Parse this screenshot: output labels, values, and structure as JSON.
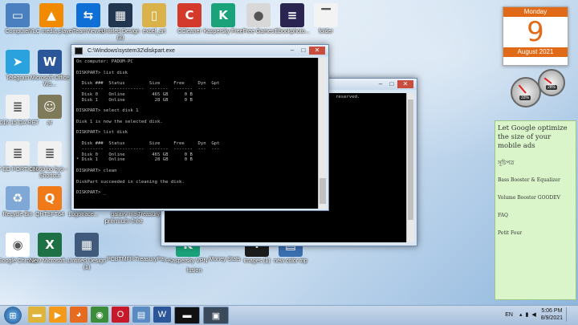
{
  "desktop_icons": [
    {
      "name": "computer",
      "label": "Computer",
      "color": "#4a7fc0",
      "glyph": "▭",
      "icon": "computer-icon"
    },
    {
      "name": "vlc",
      "label": "VLC media player",
      "color": "#f28a00",
      "glyph": "▲",
      "icon": "vlc-icon"
    },
    {
      "name": "teamviewer",
      "label": "TeamViewer",
      "color": "#0e6fd6",
      "glyph": "⇆",
      "icon": "teamviewer-icon"
    },
    {
      "name": "untitled-design-2",
      "label": "Untitled Design (2)",
      "color": "#23364f",
      "glyph": "▦",
      "icon": "image-icon"
    },
    {
      "name": "excel-art",
      "label": "excel_art",
      "color": "#d9b24a",
      "glyph": "▯",
      "icon": "folder-icon"
    },
    {
      "name": "ccleaner",
      "label": "CCleaner",
      "color": "#d33a2c",
      "glyph": "C",
      "icon": "ccleaner-icon"
    },
    {
      "name": "kaspersky-free",
      "label": "Kaspersky Free",
      "color": "#1aa37a",
      "glyph": "K",
      "icon": "kaspersky-icon"
    },
    {
      "name": "free-games",
      "label": "Free Games",
      "color": "#d8d8d8",
      "glyph": "●",
      "icon": "games-icon"
    },
    {
      "name": "ebookphoto",
      "label": "Ebookphoto...",
      "color": "#2a2450",
      "glyph": "≡",
      "icon": "image-icon"
    },
    {
      "name": "folder",
      "label": "folder",
      "color": "#f3f3f3",
      "glyph": "▔",
      "icon": "blank-icon"
    },
    {
      "name": "telegram",
      "label": "Telegram",
      "color": "#2aa2dd",
      "glyph": "➤",
      "icon": "telegram-icon"
    },
    {
      "name": "office-word",
      "label": "Microsoft Office Wo...",
      "color": "#2b579a",
      "glyph": "W",
      "icon": "word-icon"
    },
    {
      "name": "2016-15-da-ret",
      "label": "2016 15 DA RET",
      "color": "#f1f1f1",
      "glyph": "≣",
      "icon": "document-icon"
    },
    {
      "name": "ar",
      "label": "ar",
      "color": "#7e7a5a",
      "glyph": "☺",
      "icon": "photo-icon"
    },
    {
      "name": "7-ed-portion",
      "label": "7 ED PORTION",
      "color": "#f1f1f1",
      "glyph": "≣",
      "icon": "document-icon"
    },
    {
      "name": "8669-bo-hyo",
      "label": "8669 bo hyo - Shortcut",
      "color": "#f1f1f1",
      "glyph": "≣",
      "icon": "document-icon"
    },
    {
      "name": "recycle-bin",
      "label": "Recycle Bin",
      "color": "#7fa8d6",
      "glyph": "♻",
      "icon": "recycle-bin-icon"
    },
    {
      "name": "qhtsft64",
      "label": "QHTSFT64",
      "color": "#f07a1a",
      "glyph": "Q",
      "icon": "app-icon"
    },
    {
      "name": "google-chrome",
      "label": "Google Chrome",
      "color": "#ffffff",
      "glyph": "◉",
      "icon": "chrome-icon"
    },
    {
      "name": "new-microsoft",
      "label": "New Microsoft...",
      "color": "#1e7145",
      "glyph": "X",
      "icon": "excel-icon"
    },
    {
      "name": "untitled-design-1",
      "label": "Untitled Design (1)",
      "color": "#3f5a7a",
      "glyph": "▦",
      "icon": "image-icon"
    },
    {
      "name": "kaspersky-vpn",
      "label": "Kaspersky VPN",
      "color": "#1aa37a",
      "glyph": "K",
      "icon": "kaspersky-icon"
    },
    {
      "name": "images-1",
      "label": "images (1)",
      "color": "#1c1c1c",
      "glyph": "∵",
      "icon": "image-icon"
    },
    {
      "name": "new-color-trip",
      "label": "new color trip",
      "color": "#3a6fb0",
      "glyph": "▤",
      "icon": "image-icon"
    }
  ],
  "partial_labels": {
    "logotrace": "Logotrace...",
    "galaxy": "galaxy may",
    "treasury": "Treasury...",
    "premium": "premium free",
    "pcbtmfr": "PCBTMFR",
    "treasurypay": "TreasuryPay...",
    "money": "Money Stats",
    "fusion": "fusion"
  },
  "cmd_main": {
    "title": "C:\\Windows\\system32\\diskpart.exe",
    "lines": [
      "On computer: PADUM-PC",
      "",
      "DISKPART> list disk",
      "",
      "  Disk ###  Status         Size     Free     Dyn  Gpt",
      "  --------  -------------  -------  -------  ---  ---",
      "  Disk 0    Online          465 GB      0 B",
      "  Disk 1    Online           28 GB      0 B",
      "",
      "DISKPART> select disk 1",
      "",
      "Disk 1 is now the selected disk.",
      "",
      "DISKPART> list disk",
      "",
      "  Disk ###  Status         Size     Free     Dyn  Gpt",
      "  --------  -------------  -------  -------  ---  ---",
      "  Disk 0    Online          465 GB      0 B",
      "* Disk 1    Online           28 GB      0 B",
      "",
      "DISKPART> clean",
      "",
      "DiskPart succeeded in cleaning the disk.",
      "",
      "DISKPART> _"
    ]
  },
  "cmd_back": {
    "lines": [
      "reserved."
    ]
  },
  "window_buttons": {
    "minimize": "–",
    "maximize": "□",
    "close": "✕"
  },
  "calendar": {
    "day": "Monday",
    "date": "9",
    "month_year": "August 2021"
  },
  "gauges": [
    {
      "pct": "33%",
      "level": 0.33
    },
    {
      "pct": "28%",
      "level": 0.28
    }
  ],
  "note": {
    "title": "Let Google optimize the size of your mobile ads",
    "heading": "সূচিপত্র",
    "items": [
      "Bass Booster & Equalizer",
      "Volume Booster GOODEV",
      "FAQ",
      "Petit Four"
    ]
  },
  "taskbar": {
    "items": [
      {
        "name": "explorer",
        "glyph": "▬",
        "color": "#e0b43a",
        "icon": "folder-icon"
      },
      {
        "name": "media",
        "glyph": "▶",
        "color": "#f39a1a",
        "icon": "media-player-icon"
      },
      {
        "name": "firefox",
        "glyph": "◕",
        "color": "#e66b1f",
        "icon": "firefox-icon"
      },
      {
        "name": "chrome",
        "glyph": "◉",
        "color": "#3c8d3a",
        "icon": "chrome-icon"
      },
      {
        "name": "opera",
        "glyph": "O",
        "color": "#c8192b",
        "icon": "opera-icon"
      },
      {
        "name": "app",
        "glyph": "▤",
        "color": "#5a8ac2",
        "icon": "app-icon"
      },
      {
        "name": "word",
        "glyph": "W",
        "color": "#2b579a",
        "icon": "word-icon"
      },
      {
        "name": "cmd",
        "glyph": "▬",
        "color": "#111111",
        "icon": "cmd-icon"
      },
      {
        "name": "cmd2",
        "glyph": "▣",
        "color": "#3a4a5a",
        "icon": "cmd-icon"
      }
    ],
    "lang": "EN",
    "time": "5:06 PM",
    "date": "8/9/2021"
  }
}
